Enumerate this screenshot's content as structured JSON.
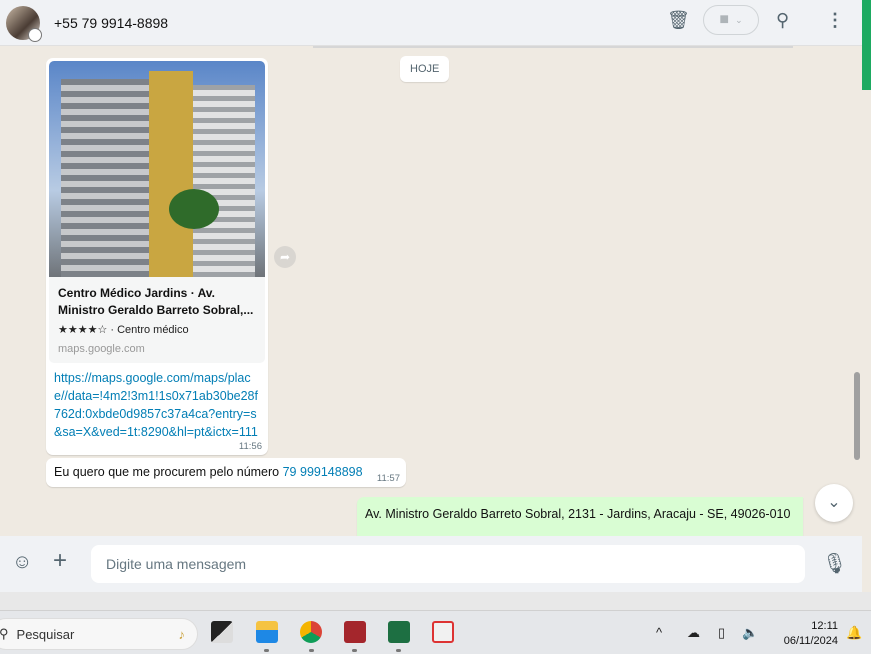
{
  "header": {
    "contact": "+55 79 9914-8898",
    "icons": [
      "avatar",
      "delete-icon",
      "video-call-icon",
      "search-icon",
      "menu-icon"
    ]
  },
  "chat": {
    "date_divider": "HOJE",
    "messages": [
      {
        "type": "link",
        "preview_title": "Centro Médico Jardins · Av. Ministro Geraldo Barreto Sobral,...",
        "preview_meta": "★★★★☆ · Centro médico",
        "preview_domain": "maps.google.com",
        "url": "https://maps.google.com/maps/place//data=!4m2!3m1!1s0x71ab30be28f762d:0xbde0d9857c37a4ca?entry=s&sa=X&ved=1t:8290&hl=pt&ictx=111",
        "time": "11:56"
      },
      {
        "type": "text",
        "text": "Eu quero que me procurem pelo número ",
        "link": "79 999148898",
        "time": "11:57"
      },
      {
        "type": "text",
        "outgoing": true,
        "text": "Av. Ministro Geraldo Barreto Sobral, 2131 - Jardins, Aracaju - SE, 49026-010"
      }
    ]
  },
  "composer": {
    "placeholder": "Digite uma mensagem"
  },
  "taskbar": {
    "search_label": "Pesquisar",
    "time": "12:11",
    "date": "06/11/2024"
  },
  "colors": {
    "accent": "#1daa61",
    "outgoing_bubble": "#d9fdd3",
    "link": "#027eb5"
  }
}
